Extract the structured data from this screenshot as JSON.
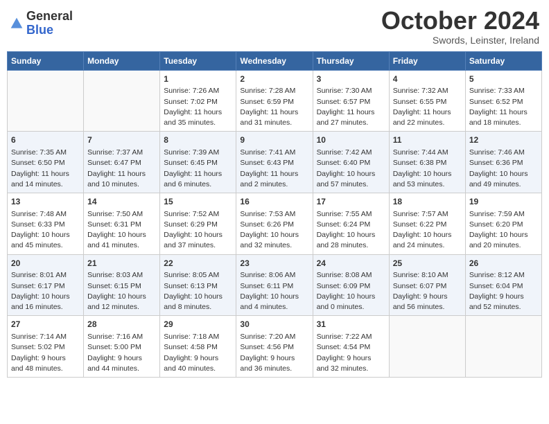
{
  "header": {
    "logo_line1": "General",
    "logo_line2": "Blue",
    "month": "October 2024",
    "location": "Swords, Leinster, Ireland"
  },
  "days_of_week": [
    "Sunday",
    "Monday",
    "Tuesday",
    "Wednesday",
    "Thursday",
    "Friday",
    "Saturday"
  ],
  "weeks": [
    [
      {
        "day": "",
        "info": ""
      },
      {
        "day": "",
        "info": ""
      },
      {
        "day": "1",
        "info": "Sunrise: 7:26 AM\nSunset: 7:02 PM\nDaylight: 11 hours and 35 minutes."
      },
      {
        "day": "2",
        "info": "Sunrise: 7:28 AM\nSunset: 6:59 PM\nDaylight: 11 hours and 31 minutes."
      },
      {
        "day": "3",
        "info": "Sunrise: 7:30 AM\nSunset: 6:57 PM\nDaylight: 11 hours and 27 minutes."
      },
      {
        "day": "4",
        "info": "Sunrise: 7:32 AM\nSunset: 6:55 PM\nDaylight: 11 hours and 22 minutes."
      },
      {
        "day": "5",
        "info": "Sunrise: 7:33 AM\nSunset: 6:52 PM\nDaylight: 11 hours and 18 minutes."
      }
    ],
    [
      {
        "day": "6",
        "info": "Sunrise: 7:35 AM\nSunset: 6:50 PM\nDaylight: 11 hours and 14 minutes."
      },
      {
        "day": "7",
        "info": "Sunrise: 7:37 AM\nSunset: 6:47 PM\nDaylight: 11 hours and 10 minutes."
      },
      {
        "day": "8",
        "info": "Sunrise: 7:39 AM\nSunset: 6:45 PM\nDaylight: 11 hours and 6 minutes."
      },
      {
        "day": "9",
        "info": "Sunrise: 7:41 AM\nSunset: 6:43 PM\nDaylight: 11 hours and 2 minutes."
      },
      {
        "day": "10",
        "info": "Sunrise: 7:42 AM\nSunset: 6:40 PM\nDaylight: 10 hours and 57 minutes."
      },
      {
        "day": "11",
        "info": "Sunrise: 7:44 AM\nSunset: 6:38 PM\nDaylight: 10 hours and 53 minutes."
      },
      {
        "day": "12",
        "info": "Sunrise: 7:46 AM\nSunset: 6:36 PM\nDaylight: 10 hours and 49 minutes."
      }
    ],
    [
      {
        "day": "13",
        "info": "Sunrise: 7:48 AM\nSunset: 6:33 PM\nDaylight: 10 hours and 45 minutes."
      },
      {
        "day": "14",
        "info": "Sunrise: 7:50 AM\nSunset: 6:31 PM\nDaylight: 10 hours and 41 minutes."
      },
      {
        "day": "15",
        "info": "Sunrise: 7:52 AM\nSunset: 6:29 PM\nDaylight: 10 hours and 37 minutes."
      },
      {
        "day": "16",
        "info": "Sunrise: 7:53 AM\nSunset: 6:26 PM\nDaylight: 10 hours and 32 minutes."
      },
      {
        "day": "17",
        "info": "Sunrise: 7:55 AM\nSunset: 6:24 PM\nDaylight: 10 hours and 28 minutes."
      },
      {
        "day": "18",
        "info": "Sunrise: 7:57 AM\nSunset: 6:22 PM\nDaylight: 10 hours and 24 minutes."
      },
      {
        "day": "19",
        "info": "Sunrise: 7:59 AM\nSunset: 6:20 PM\nDaylight: 10 hours and 20 minutes."
      }
    ],
    [
      {
        "day": "20",
        "info": "Sunrise: 8:01 AM\nSunset: 6:17 PM\nDaylight: 10 hours and 16 minutes."
      },
      {
        "day": "21",
        "info": "Sunrise: 8:03 AM\nSunset: 6:15 PM\nDaylight: 10 hours and 12 minutes."
      },
      {
        "day": "22",
        "info": "Sunrise: 8:05 AM\nSunset: 6:13 PM\nDaylight: 10 hours and 8 minutes."
      },
      {
        "day": "23",
        "info": "Sunrise: 8:06 AM\nSunset: 6:11 PM\nDaylight: 10 hours and 4 minutes."
      },
      {
        "day": "24",
        "info": "Sunrise: 8:08 AM\nSunset: 6:09 PM\nDaylight: 10 hours and 0 minutes."
      },
      {
        "day": "25",
        "info": "Sunrise: 8:10 AM\nSunset: 6:07 PM\nDaylight: 9 hours and 56 minutes."
      },
      {
        "day": "26",
        "info": "Sunrise: 8:12 AM\nSunset: 6:04 PM\nDaylight: 9 hours and 52 minutes."
      }
    ],
    [
      {
        "day": "27",
        "info": "Sunrise: 7:14 AM\nSunset: 5:02 PM\nDaylight: 9 hours and 48 minutes."
      },
      {
        "day": "28",
        "info": "Sunrise: 7:16 AM\nSunset: 5:00 PM\nDaylight: 9 hours and 44 minutes."
      },
      {
        "day": "29",
        "info": "Sunrise: 7:18 AM\nSunset: 4:58 PM\nDaylight: 9 hours and 40 minutes."
      },
      {
        "day": "30",
        "info": "Sunrise: 7:20 AM\nSunset: 4:56 PM\nDaylight: 9 hours and 36 minutes."
      },
      {
        "day": "31",
        "info": "Sunrise: 7:22 AM\nSunset: 4:54 PM\nDaylight: 9 hours and 32 minutes."
      },
      {
        "day": "",
        "info": ""
      },
      {
        "day": "",
        "info": ""
      }
    ]
  ]
}
